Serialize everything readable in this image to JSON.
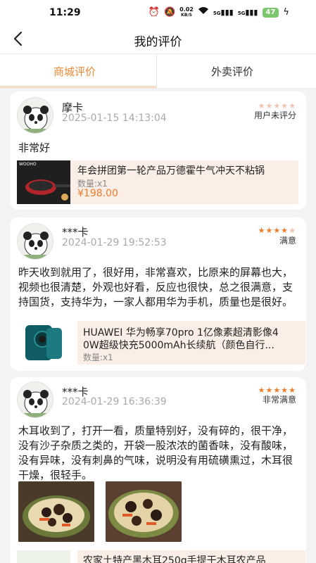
{
  "status_bar": {
    "time": "11:29",
    "network_speed": "0.02",
    "network_unit": "KB/S",
    "signal_1": "5G",
    "signal_2": "5G",
    "battery": "47"
  },
  "header": {
    "title": "我的评价"
  },
  "tabs": [
    {
      "label": "商城评价",
      "active": true
    },
    {
      "label": "外卖评价",
      "active": false
    }
  ],
  "reviews": [
    {
      "username": "摩卡",
      "date": "2025-01-15 14:13:04",
      "stars": 0,
      "rating_label": "用户未评分",
      "text": "非常好",
      "product": {
        "name": "年会拼团第一轮产品万德霍牛气冲天不粘锅",
        "quantity": "数量:x1",
        "price": "¥198.00",
        "thumb_brand": "WOOHO"
      }
    },
    {
      "username": "***卡",
      "date": "2024-01-29 19:52:53",
      "stars": 4,
      "rating_label": "满意",
      "text": "昨天收到就用了，很好用，非常喜欢，比原来的屏幕也大，视频也很清楚，外观也好看，反应也很快，总之很满意，支持国货，支持华为，一家人都用华为手机，质量也是很好。",
      "product": {
        "name_line1": "HUAWEI 华为畅享70pro 1亿像素超清影像4",
        "name_line2": "0W超级快充5000mAh长续航（颜色自行...",
        "quantity": "数量:x1"
      }
    },
    {
      "username": "***卡",
      "date": "2024-01-29 16:36:39",
      "stars": 5,
      "rating_label": "非常满意",
      "text": "木耳收到了，打开一看，质量特别好，没有碎的，很干净，没有沙子杂质之类的，开袋一股浓浓的菌香味，没有酸味，没有异味，没有刺鼻的气味，说明没有用硫磺熏过，木耳很干燥，很轻手。",
      "product": {
        "name": "农家土特产黑木耳250g手提干木耳农产品"
      }
    }
  ],
  "colors": {
    "accent": "#f07c2a",
    "tab_active": "#e88b3a",
    "product_bg": "#fbeee6"
  }
}
